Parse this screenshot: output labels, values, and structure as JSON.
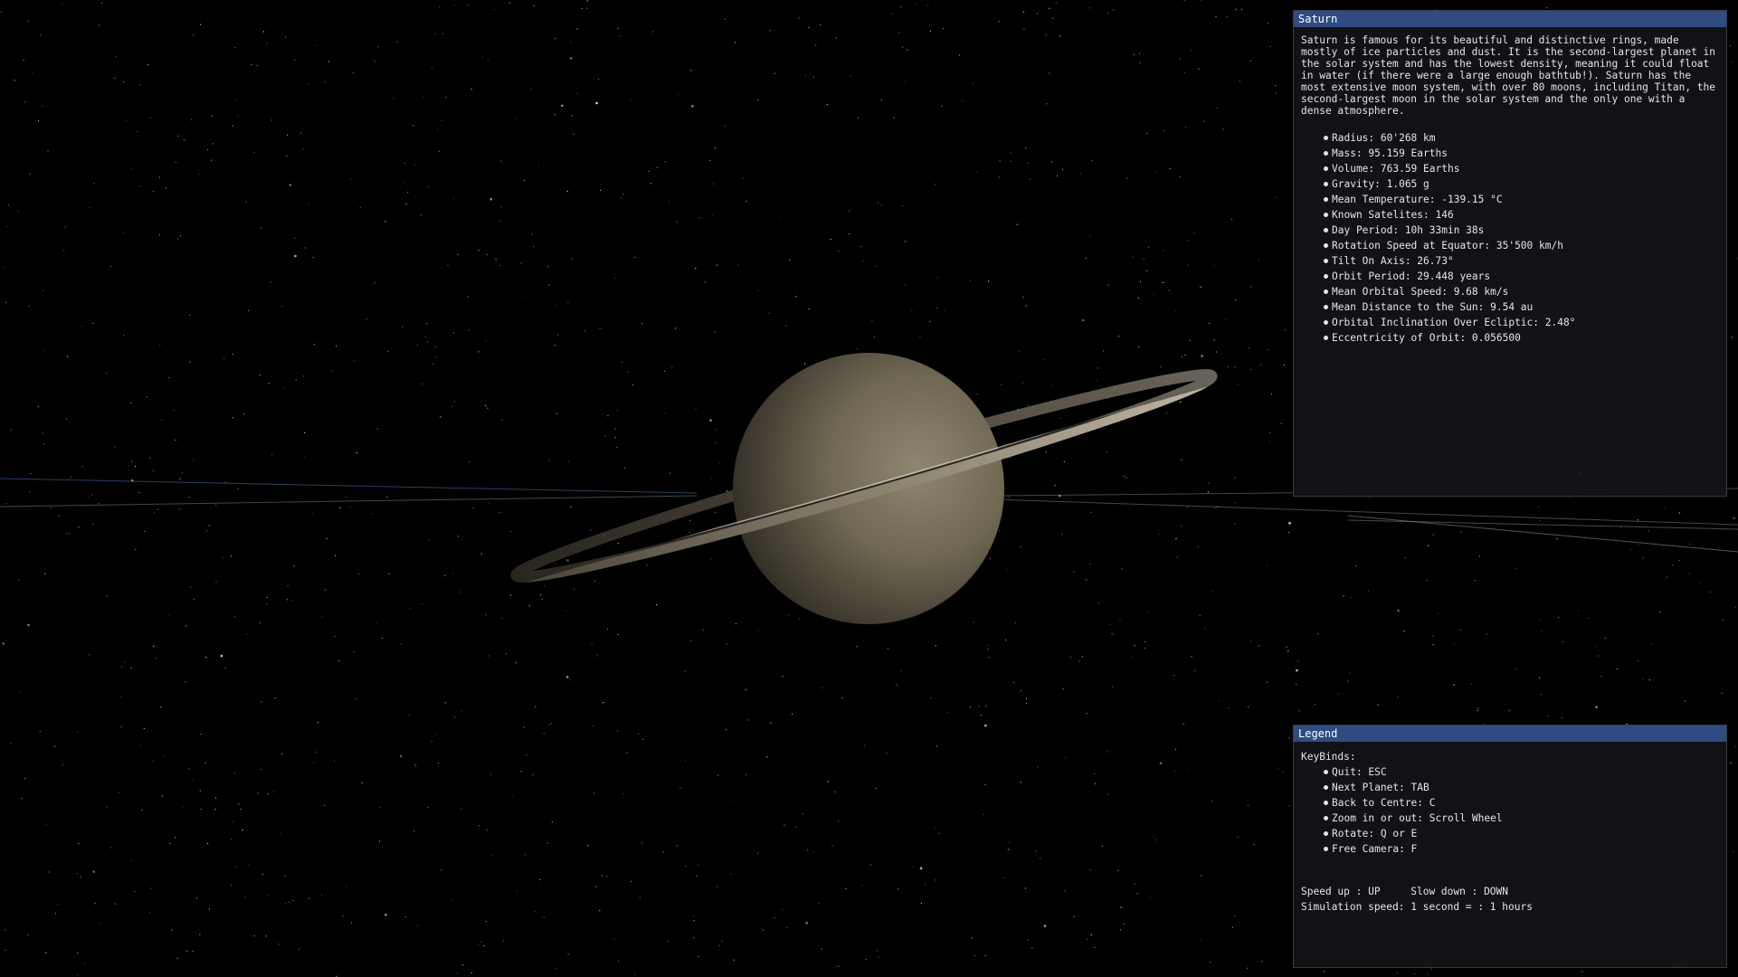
{
  "scene": {
    "planet_icon": "saturn-with-rings",
    "background": "starfield",
    "colors": {
      "space": "#000000",
      "planet_lit": "#8a8168",
      "planet_dark": "#2b2820",
      "ring": "#7e7566",
      "orbit_line": "#9aa0a8"
    }
  },
  "info_panel": {
    "title": "Saturn",
    "description": "Saturn is famous for its beautiful and distinctive rings, made mostly of ice particles and dust. It is the second-largest planet in the solar system and has the lowest density, meaning it could float in water (if there were a large enough bathtub!). Saturn has the most extensive moon system, with over 80 moons, including Titan, the second-largest moon in the solar system and the only one with a dense atmosphere.",
    "stats": [
      "Radius: 60'268 km",
      "Mass: 95.159 Earths",
      "Volume: 763.59 Earths",
      "Gravity: 1.065 g",
      "Mean Temperature: -139.15 °C",
      "Known Satelites: 146",
      "Day Period: 10h 33min 38s",
      "Rotation Speed at Equator: 35'500 km/h",
      "Tilt On Axis: 26.73°",
      "Orbit Period: 29.448 years",
      "Mean Orbital Speed: 9.68 km/s",
      "Mean Distance to the Sun: 9.54 au",
      "Orbital Inclination Over Ecliptic: 2.48°",
      "Eccentricity of Orbit: 0.056500"
    ]
  },
  "legend_panel": {
    "title": "Legend",
    "keybinds_heading": "KeyBinds:",
    "keybinds": [
      "Quit: ESC",
      "Next Planet: TAB",
      "Back to Centre: C",
      "Zoom in or out: Scroll Wheel",
      "Rotate: Q or E",
      "Free Camera: F"
    ],
    "speed_controls": "Speed up : UP     Slow down : DOWN",
    "simulation_speed": "Simulation speed: 1 second = : 1 hours"
  },
  "theme": {
    "title_bar": "#2e4b82",
    "panel_bg": "#121316",
    "text": "#e6e6e6"
  }
}
